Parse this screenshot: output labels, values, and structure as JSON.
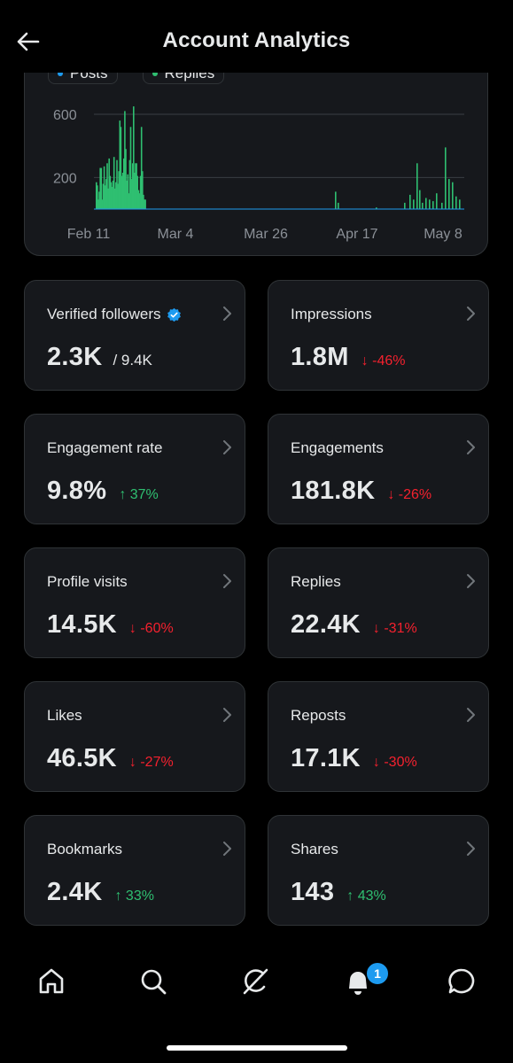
{
  "header": {
    "title": "Account Analytics"
  },
  "chart": {
    "legend": [
      {
        "label": "Posts",
        "color": "#1d9bf0"
      },
      {
        "label": "Replies",
        "color": "#2fbf71"
      }
    ]
  },
  "chart_data": {
    "type": "bar",
    "y_ticks": [
      "600",
      "200"
    ],
    "x_ticks": [
      "Feb 11",
      "Mar 4",
      "Mar 26",
      "Apr 17",
      "May 8"
    ],
    "ylim": [
      0,
      700
    ],
    "series": [
      {
        "name": "Replies",
        "color": "#2fbf71",
        "values": [
          170,
          150,
          60,
          110,
          260,
          260,
          60,
          160,
          270,
          150,
          190,
          290,
          130,
          320,
          210,
          170,
          140,
          180,
          330,
          130,
          170,
          310,
          160,
          240,
          560,
          520,
          210,
          230,
          320,
          620,
          380,
          180,
          220,
          100,
          310,
          520,
          190,
          290,
          650,
          230,
          290,
          290,
          210,
          120,
          100,
          210,
          520,
          240,
          90,
          60,
          60,
          0,
          0,
          0,
          0,
          0,
          0,
          0,
          0,
          0,
          0,
          0,
          0,
          0,
          0,
          0,
          0,
          0,
          0,
          0,
          0,
          0,
          0,
          0,
          0,
          0,
          0,
          0,
          0,
          0,
          0,
          0,
          0,
          0,
          0,
          0,
          0,
          0,
          0,
          0,
          0,
          0,
          0,
          0,
          0,
          0,
          0,
          0,
          0,
          0,
          0,
          0,
          0,
          0,
          0,
          0,
          0,
          0,
          0,
          0,
          0,
          0,
          0,
          0,
          0,
          0,
          0,
          0,
          0,
          0,
          0,
          0,
          0,
          0,
          0,
          0,
          0,
          0,
          0,
          0,
          0,
          0,
          0,
          0,
          0,
          0,
          0,
          0,
          0,
          0,
          0,
          0,
          0,
          0,
          0,
          0,
          0,
          0,
          0,
          0,
          0,
          0,
          0,
          0,
          0,
          0,
          0,
          0,
          0,
          0,
          0,
          0,
          0,
          0,
          0,
          0,
          0,
          0,
          0,
          0,
          0,
          0,
          0,
          0,
          0,
          0,
          0,
          0,
          0,
          0,
          0,
          0,
          0,
          0,
          0,
          0,
          0,
          0,
          0
        ]
      },
      {
        "name": "Posts",
        "color": "#1d9bf0",
        "values": [
          10,
          10,
          10,
          10,
          10,
          10,
          10,
          10,
          10,
          10
        ]
      }
    ]
  },
  "stats": [
    {
      "label": "Verified followers",
      "value": "2.3K",
      "total": "/ 9.4K",
      "change": "",
      "direction": "none",
      "verified": true
    },
    {
      "label": "Impressions",
      "value": "1.8M",
      "total": "",
      "change": "↓ -46%",
      "direction": "down"
    },
    {
      "label": "Engagement rate",
      "value": "9.8%",
      "total": "",
      "change": "↑ 37%",
      "direction": "up"
    },
    {
      "label": "Engagements",
      "value": "181.8K",
      "total": "",
      "change": "↓ -26%",
      "direction": "down"
    },
    {
      "label": "Profile visits",
      "value": "14.5K",
      "total": "",
      "change": "↓ -60%",
      "direction": "down"
    },
    {
      "label": "Replies",
      "value": "22.4K",
      "total": "",
      "change": "↓ -31%",
      "direction": "down"
    },
    {
      "label": "Likes",
      "value": "46.5K",
      "total": "",
      "change": "↓ -27%",
      "direction": "down"
    },
    {
      "label": "Reposts",
      "value": "17.1K",
      "total": "",
      "change": "↓ -30%",
      "direction": "down"
    },
    {
      "label": "Bookmarks",
      "value": "2.4K",
      "total": "",
      "change": "↑ 33%",
      "direction": "up"
    },
    {
      "label": "Shares",
      "value": "143",
      "total": "",
      "change": "↑ 43%",
      "direction": "up"
    }
  ],
  "tabbar": {
    "items": [
      {
        "icon": "home-icon"
      },
      {
        "icon": "search-icon"
      },
      {
        "icon": "grok-icon"
      },
      {
        "icon": "bell-icon"
      },
      {
        "icon": "messages-icon"
      }
    ],
    "notification_badge": "1"
  },
  "colors": {
    "up": "#2fbf71",
    "down": "#f4212e",
    "accent": "#1d9bf0",
    "card": "#16181c"
  }
}
